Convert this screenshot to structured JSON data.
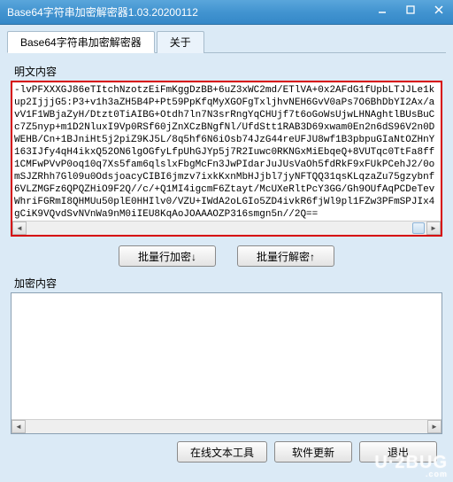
{
  "window": {
    "title": "Base64字符串加密解密器1.03.20200112"
  },
  "tabs": {
    "main": "Base64字符串加密解密器",
    "about": "关于"
  },
  "labels": {
    "plaintext": "明文内容",
    "ciphertext": "加密内容"
  },
  "plaintext_value": "-lvPFXXXGJ86eTItchNzotzEiFmKggDzBB+6uZ3xWC2md/ETlVA+0x2AFdG1fUpbLTJJLe1kup2IjjjG5:P3+v1h3aZH5B4P+Pt59PpKfqMyXGOFgTxljhvNEH6GvV0aPs7O6BhDbYI2Ax/avV1F1WBjaZyH/Dtzt0TiAIBG+Otdh7ln7N3srRngYqCHUjf7t6oGoWsUjwLHNAghtlBUsBuCc7Z5nyp+m1D2NluxI9Vp0RSf60jZnXCzBNgfNl/UfdStt1RAB3D69xwam0En2n6dS96V2n0DWEHB/Cn+1BJniHt5j2piZ9KJ5L/8q5hf6N6iOsb74JzG44reUFJU8wf1B3pbpuGIaNtOZHnY163IJfy4qH4ikxQ52ON6lgOGfyLfpUhGJYp5j7R2Iuwc0RKNGxMiEbqeQ+8VUTqc0TtFa8ff1CMFwPVvP0oq10q7Xs5fam6qlslxFbgMcFn3JwPIdarJuJUsVaOh5fdRkF9xFUkPCehJ2/0omSJZRhh7Gl09u0OdsjoacyCIBI6jmzv7ixkKxnMbHJjbl7jyNFTQQ31qsKLqzaZu75gzybnf6VLZMGFz6QPQZHiO9F2Q//c/+Q1MI4igcmF6Ztayt/McUXeRltPcY3GG/Gh9OUfAqPCDeTevWhriFGRmI8QHMUu50plE0HHIlv0/VZU+IWdA2oLGIo5ZD4ivkR6fjWl9pl1FZw3PFmSPJIx4gCiK9VQvdSvNVnWa9nM0iIEU8KqAoJOAAAOZP316smgn5n//2Q==",
  "ciphertext_value": "",
  "buttons": {
    "batch_encrypt": "批量行加密↓",
    "batch_decrypt": "批量行解密↑",
    "online_text_tool": "在线文本工具",
    "software_update": "软件更新",
    "exit": "退出"
  },
  "watermark": {
    "main": "U·2BUG",
    "sub": ".com"
  }
}
